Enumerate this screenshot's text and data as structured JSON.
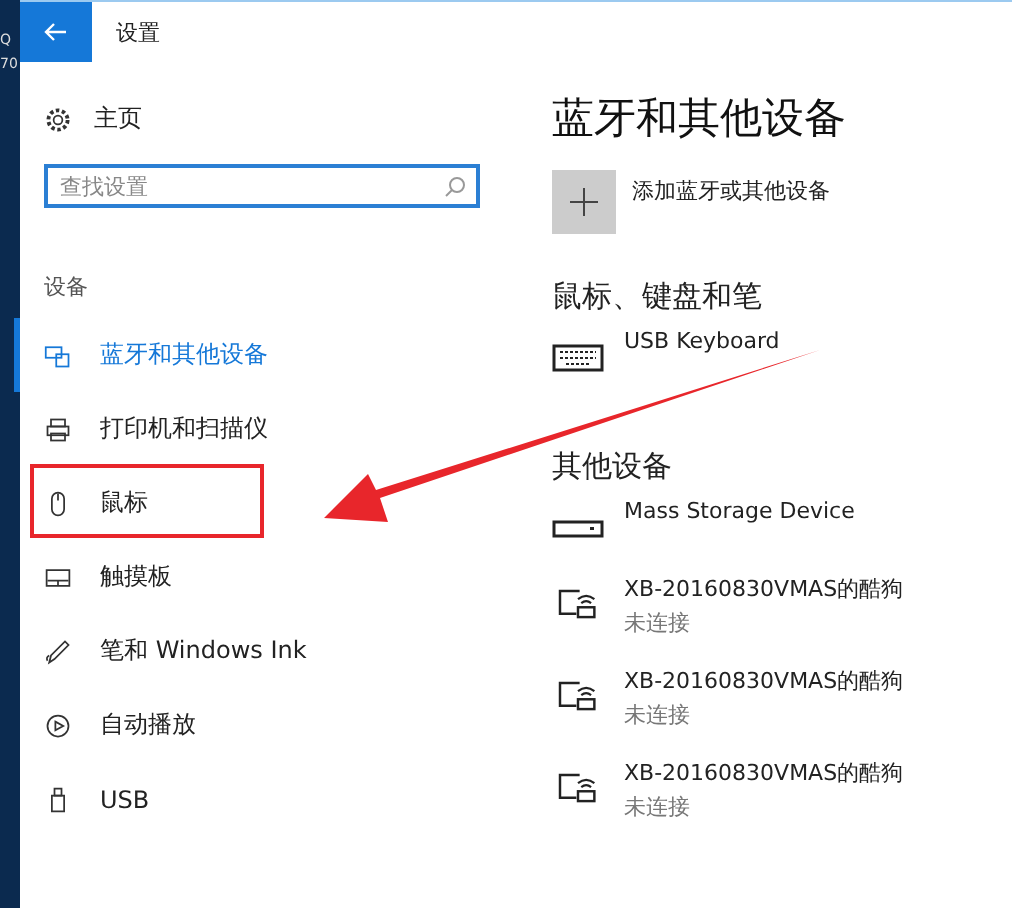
{
  "desktop_edge": {
    "texts": [
      "Q",
      "70"
    ]
  },
  "window": {
    "title": "设置"
  },
  "sidebar": {
    "home": "主页",
    "search": {
      "placeholder": "查找设置"
    },
    "section": "设备",
    "items": [
      {
        "label": "蓝牙和其他设备",
        "kind": "bluetooth",
        "selected": true
      },
      {
        "label": "打印机和扫描仪",
        "kind": "printer",
        "selected": false
      },
      {
        "label": "鼠标",
        "kind": "mouse",
        "selected": false
      },
      {
        "label": "触摸板",
        "kind": "touchpad",
        "selected": false
      },
      {
        "label": "笔和 Windows Ink",
        "kind": "pen",
        "selected": false
      },
      {
        "label": "自动播放",
        "kind": "autoplay",
        "selected": false
      },
      {
        "label": "USB",
        "kind": "usb",
        "selected": false
      }
    ]
  },
  "content": {
    "title": "蓝牙和其他设备",
    "add_button": "添加蓝牙或其他设备",
    "groups": [
      {
        "heading": "鼠标、键盘和笔",
        "devices": [
          {
            "name": "USB Keyboard",
            "kind": "keyboard"
          }
        ]
      },
      {
        "heading": "其他设备",
        "devices": [
          {
            "name": "Mass Storage Device",
            "kind": "drive"
          },
          {
            "name": "XB-20160830VMAS的酷狗",
            "status": "未连接",
            "kind": "wireless"
          },
          {
            "name": "XB-20160830VMAS的酷狗",
            "status": "未连接",
            "kind": "wireless"
          },
          {
            "name": "XB-20160830VMAS的酷狗",
            "status": "未连接",
            "kind": "wireless"
          }
        ]
      }
    ]
  },
  "annotation": {
    "highlight_frame": true,
    "arrow": true
  }
}
